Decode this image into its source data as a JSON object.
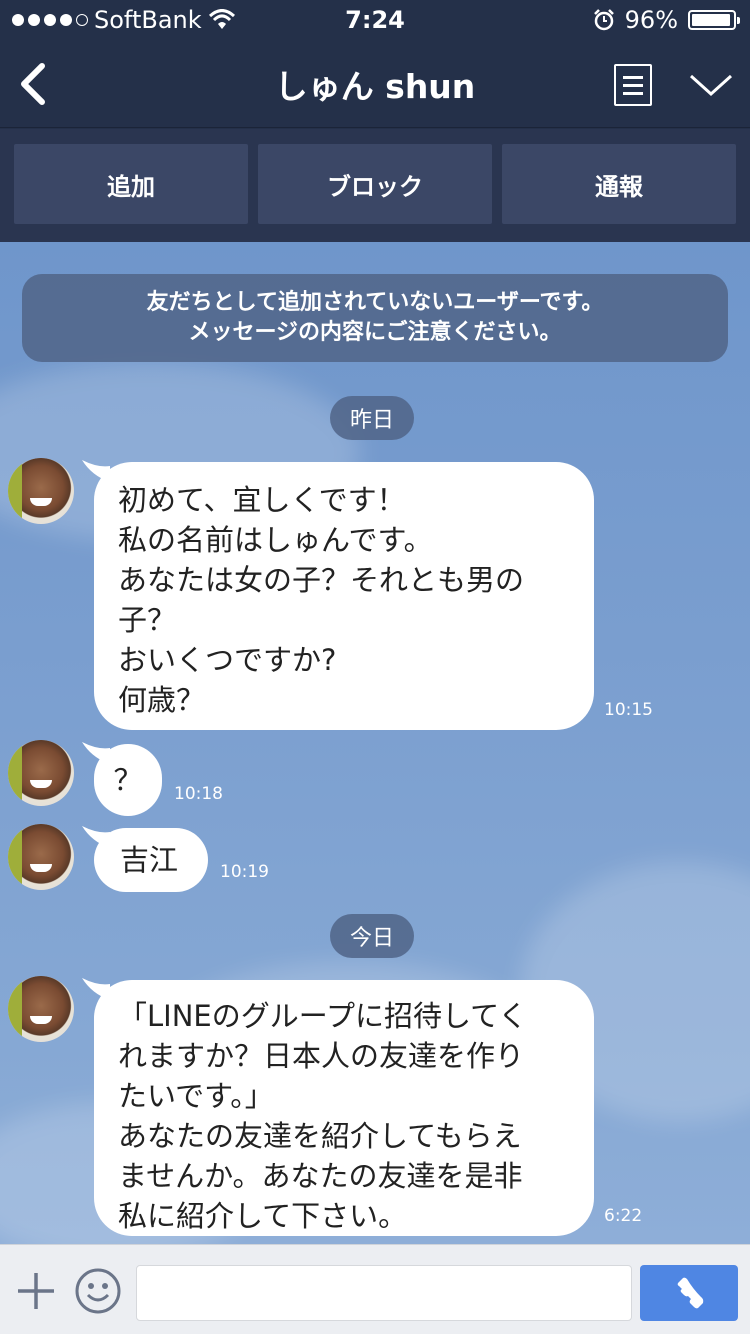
{
  "status_bar": {
    "carrier": "SoftBank",
    "time": "7:24",
    "battery": "96%",
    "battery_level": 0.96
  },
  "header": {
    "title": "しゅん shun",
    "icons": [
      "back-chevron-icon",
      "menu-list-icon",
      "chevron-down-icon"
    ]
  },
  "actions": {
    "add": "追加",
    "block": "ブロック",
    "report": "通報"
  },
  "chat": {
    "notice_line1": "友だちとして追加されていないユーザーです。",
    "notice_line2": "メッセージの内容にご注意ください。",
    "date_yesterday": "昨日",
    "date_today": "今日",
    "messages": [
      {
        "text": "初めて、宜しくです！\n私の名前はしゅんです。\nあなたは女の子？それとも男の\n子？\nおいくつですか?\n何歳？",
        "time": "10:15"
      },
      {
        "text": "？",
        "time": "10:18"
      },
      {
        "text": "吉江",
        "time": "10:19"
      },
      {
        "text": "「LINEのグループに招待してく\nれますか？日本人の友達を作り\nたいです。」\nあなたの友達を紹介してもらえ\nませんか。あなたの友達を是非\n私に紹介して下さい。",
        "time": "6:22"
      }
    ]
  },
  "input_bar": {
    "placeholder": "",
    "call_color": "#4f86e3"
  }
}
